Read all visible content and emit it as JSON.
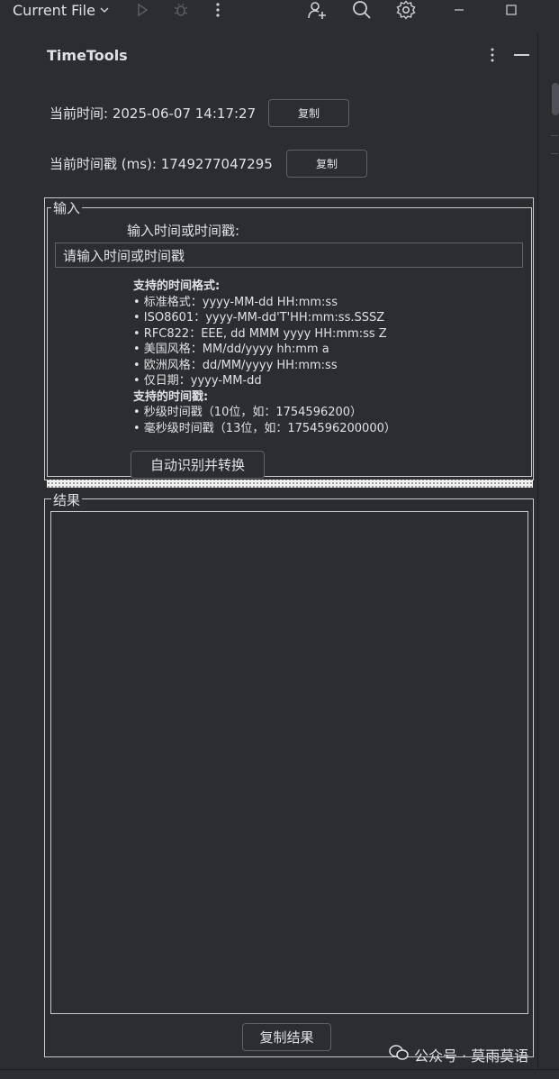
{
  "toolbar": {
    "run_config_label": "Current File",
    "icons": [
      "chevron-down-icon",
      "run-icon",
      "debug-icon",
      "more-vertical-icon",
      "add-user-icon",
      "search-icon",
      "settings-icon",
      "minimize-window-icon",
      "maximize-window-icon"
    ]
  },
  "panel": {
    "title": "TimeTools",
    "current_time_label": "当前时间: 2025-06-07 14:17:27",
    "current_time_copy": "复制",
    "current_timestamp_label": "当前时间戳 (ms): 1749277047295",
    "current_timestamp_copy": "复制"
  },
  "input_group": {
    "label": "输入",
    "prompt": "输入时间或时间戳:",
    "input_value": "请输入时间或时间戳",
    "help_lines": [
      {
        "text": "支持的时间格式:",
        "bold": true
      },
      {
        "text": "• 标准格式：yyyy-MM-dd HH:mm:ss",
        "bold": false
      },
      {
        "text": "• ISO8601：yyyy-MM-dd'T'HH:mm:ss.SSSZ",
        "bold": false
      },
      {
        "text": "• RFC822：EEE, dd MMM yyyy HH:mm:ss Z",
        "bold": false
      },
      {
        "text": "• 美国风格：MM/dd/yyyy hh:mm a",
        "bold": false
      },
      {
        "text": "• 欧洲风格：dd/MM/yyyy HH:mm:ss",
        "bold": false
      },
      {
        "text": "• 仅日期：yyyy-MM-dd",
        "bold": false
      },
      {
        "text": "支持的时间戳:",
        "bold": true
      },
      {
        "text": "• 秒级时间戳（10位，如：1754596200）",
        "bold": false
      },
      {
        "text": "• 毫秒级时间戳（13位，如：1754596200000）",
        "bold": false
      }
    ],
    "convert_button": "自动识别并转换"
  },
  "result_group": {
    "label": "结果",
    "result_text": "",
    "copy_button": "复制结果"
  },
  "watermark": {
    "text": "公众号 · 莫雨莫语"
  }
}
